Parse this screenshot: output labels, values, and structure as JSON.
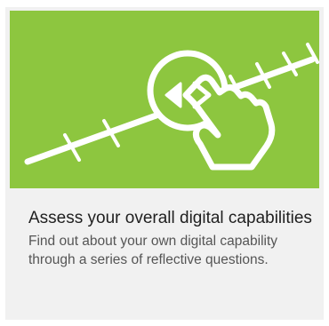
{
  "card": {
    "title": "Assess your overall digital capabilities",
    "description": "Find out about your own digital capability through a series of reflective questions.",
    "image_icon": "touch-slider-icon",
    "colors": {
      "image_background": "#8dc63f",
      "card_background": "#f1f1f1",
      "icon_stroke": "#ffffff",
      "title_text": "#1f1f1f",
      "description_text": "#555555"
    }
  }
}
